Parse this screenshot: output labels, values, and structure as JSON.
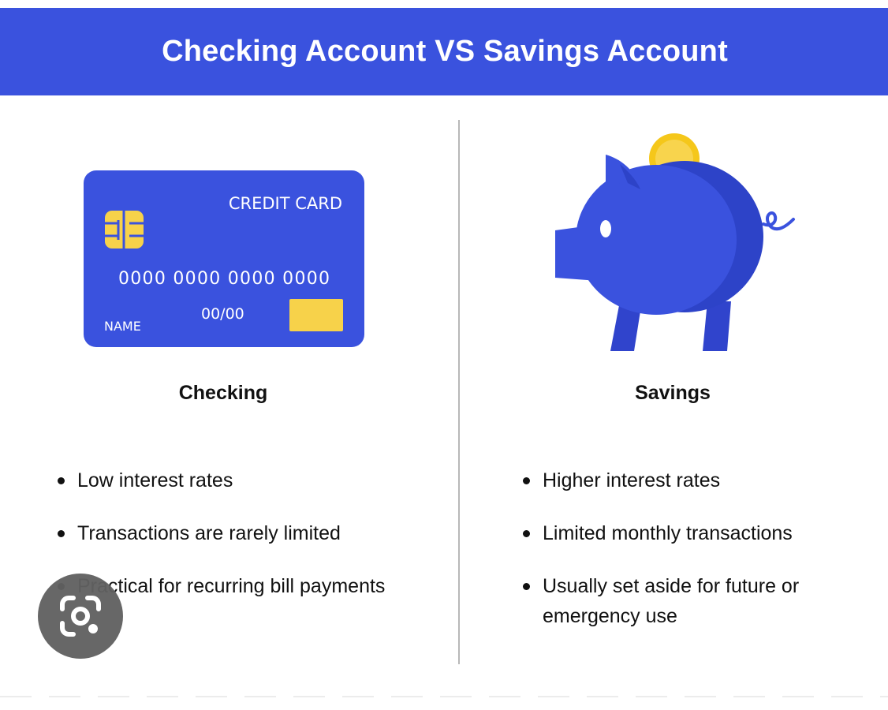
{
  "header": {
    "title": "Checking Account VS Savings Account",
    "background_color": "#3a52de"
  },
  "checking": {
    "title": "Checking",
    "card": {
      "label": "CREDIT CARD",
      "number": "0000 0000 0000 0000",
      "expiry": "00/00",
      "name": "NAME",
      "card_color": "#3a52de",
      "chip_color": "#f7d24a"
    },
    "items": [
      "Low interest rates",
      "Transactions are rarely limited",
      "Practical for recurring bill payments"
    ]
  },
  "savings": {
    "title": "Savings",
    "piggy_bank_color": "#3a52de",
    "coin_color": "#f5c71a",
    "items": [
      "Higher interest rates",
      "Limited monthly transactions",
      "Usually set aside for future or emergency use"
    ]
  },
  "overlay": {
    "icon": "lens-camera-icon"
  }
}
